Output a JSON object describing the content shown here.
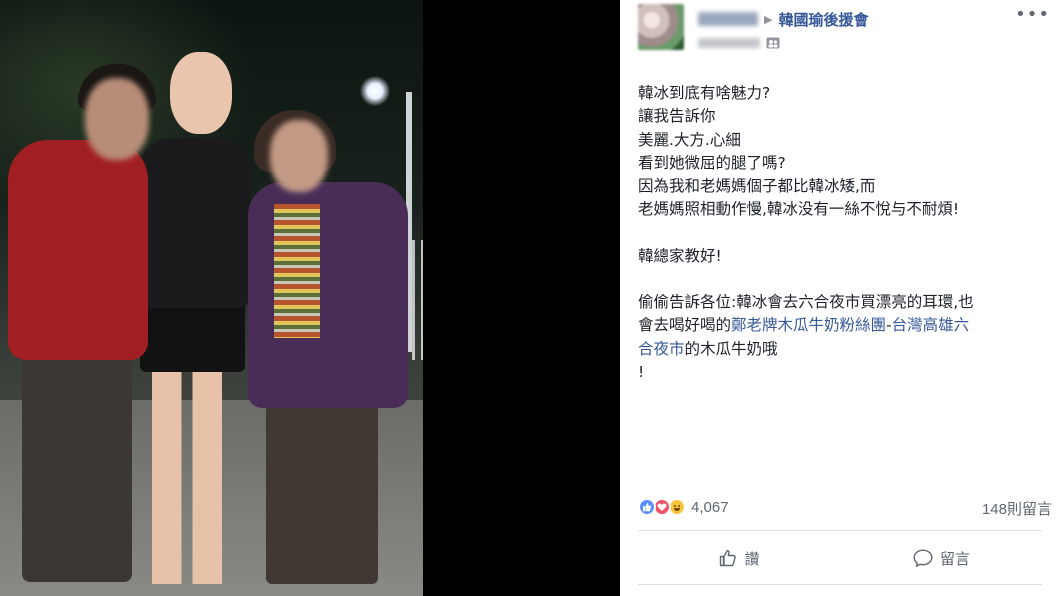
{
  "photo": {
    "alt": ""
  },
  "post": {
    "group_name": "韓國瑜後援會",
    "more_icon": "more-dots-icon",
    "audience_icon": "group-audience-icon",
    "body_lines": [
      "韓冰到底有啥魅力?",
      "讓我告訴你",
      "美麗.大方.心細",
      "看到她微屈的腿了嗎?",
      "因為我和老媽媽個子都比韓冰矮,而",
      "老媽媽照相動作慢,韓冰没有一絲不悅与不耐煩!"
    ],
    "body_line_7": "韓總家教好!",
    "body_line_8": "偷偷告訴各位:韓冰會去六合夜市買漂亮的耳環,也",
    "body_line_9_prefix": "會去喝好喝的",
    "body_link_1": "鄭老牌木瓜牛奶粉絲團",
    "body_link_sep": "-",
    "body_link_2_part1": "台灣高雄六",
    "body_link_2_part2": "合夜市",
    "body_line_10_suffix": "的木瓜牛奶哦",
    "body_line_11": "!"
  },
  "stats": {
    "reaction_count": "4,067",
    "comment_count": "148則留言",
    "reaction_icons": [
      "like-reaction-icon",
      "love-reaction-icon",
      "haha-reaction-icon"
    ]
  },
  "actions": {
    "like_label": "讚",
    "comment_label": "留言"
  },
  "colors": {
    "link": "#365899",
    "text": "#1d2129",
    "muted": "#606770",
    "like": "#5890ff",
    "love": "#f25268",
    "haha": "#f7c63f"
  }
}
